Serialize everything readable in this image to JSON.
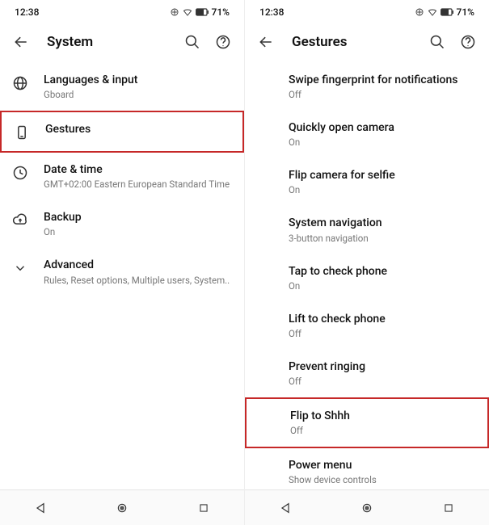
{
  "status": {
    "time": "12:38",
    "battery": "71%"
  },
  "left": {
    "title": "System",
    "items": [
      {
        "title": "Languages & input",
        "sub": "Gboard"
      },
      {
        "title": "Gestures",
        "sub": ""
      },
      {
        "title": "Date & time",
        "sub": "GMT+02:00 Eastern European Standard Time"
      },
      {
        "title": "Backup",
        "sub": "On"
      },
      {
        "title": "Advanced",
        "sub": "Rules, Reset options, Multiple users, System.."
      }
    ]
  },
  "right": {
    "title": "Gestures",
    "items": [
      {
        "title": "Swipe fingerprint for notifications",
        "sub": "Off"
      },
      {
        "title": "Quickly open camera",
        "sub": "On"
      },
      {
        "title": "Flip camera for selfie",
        "sub": "On"
      },
      {
        "title": "System navigation",
        "sub": "3-button navigation"
      },
      {
        "title": "Tap to check phone",
        "sub": "On"
      },
      {
        "title": "Lift to check phone",
        "sub": "Off"
      },
      {
        "title": "Prevent ringing",
        "sub": "Off"
      },
      {
        "title": "Flip to Shhh",
        "sub": "Off"
      },
      {
        "title": "Power menu",
        "sub": "Show device controls"
      }
    ]
  },
  "colors": {
    "highlight": "#c62828"
  }
}
